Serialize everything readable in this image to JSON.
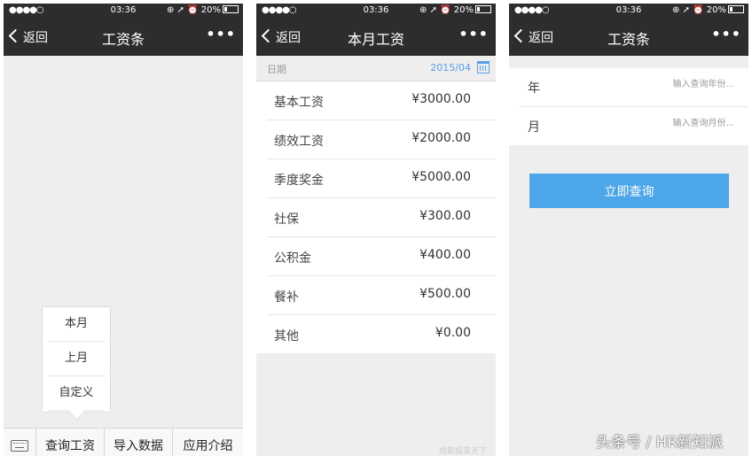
{
  "status": {
    "signal": "●●●●○",
    "time": "03:36",
    "right": "⊕ ➚ ⏰ 20%"
  },
  "nav": {
    "back": "返回",
    "more": "•••"
  },
  "screen1": {
    "title": "工资条",
    "popup": [
      "本月",
      "上月",
      "自定义"
    ],
    "menu": [
      "查询工资",
      "导入数据",
      "应用介绍"
    ],
    "kbd_tip": "^"
  },
  "screen2": {
    "title": "本月工资",
    "date_label": "日期",
    "date_value": "2015/04",
    "rows": [
      {
        "k": "基本工资",
        "v": "¥3000.00"
      },
      {
        "k": "绩效工资",
        "v": "¥2000.00"
      },
      {
        "k": "季度奖金",
        "v": "¥5000.00"
      },
      {
        "k": "社保",
        "v": "¥300.00"
      },
      {
        "k": "公积金",
        "v": "¥400.00"
      },
      {
        "k": "餐补",
        "v": "¥500.00"
      },
      {
        "k": "其他",
        "v": "¥0.00"
      }
    ],
    "watermark": "成都指掌天下"
  },
  "screen3": {
    "title": "工资条",
    "year_label": "年",
    "year_placeholder": "输入查询年份...",
    "month_label": "月",
    "month_placeholder": "输入查询月份...",
    "button": "立即查询"
  },
  "credit": "头条号 / HR新知派",
  "colors": {
    "navbar": "#2d2d2f",
    "accent": "#4da6ea",
    "link": "#56a0e8"
  }
}
